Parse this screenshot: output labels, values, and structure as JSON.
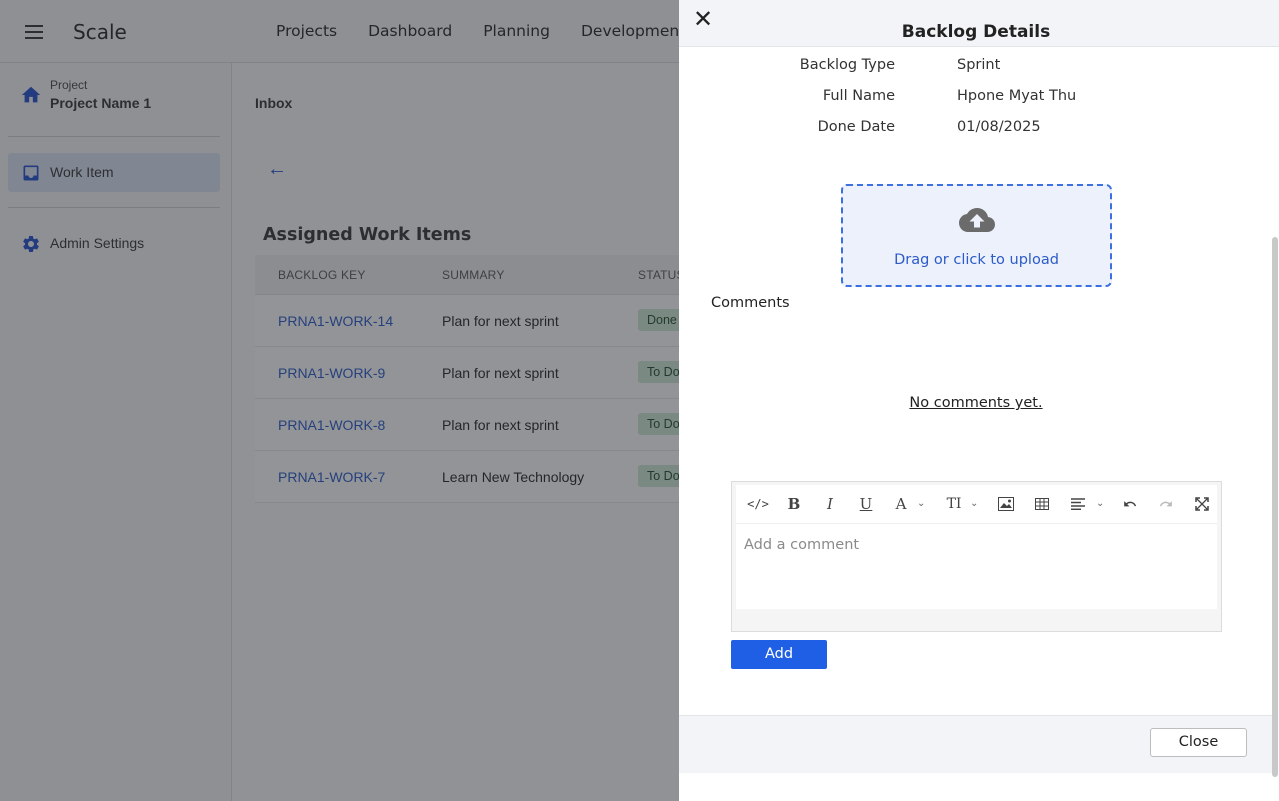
{
  "app": {
    "title": "Scale",
    "nav": [
      "Projects",
      "Dashboard",
      "Planning",
      "Development"
    ]
  },
  "sidebar": {
    "project_caption": "Project",
    "project_name": "Project Name 1",
    "items": [
      {
        "label": "Work Item",
        "icon": "inbox-icon",
        "active": true
      },
      {
        "label": "Admin Settings",
        "icon": "gear-icon",
        "active": false
      }
    ]
  },
  "main": {
    "breadcrumb": "Inbox",
    "back_icon": "←",
    "section_title": "Assigned Work Items",
    "columns": [
      "BACKLOG KEY",
      "SUMMARY",
      "STATUS"
    ],
    "rows": [
      {
        "key": "PRNA1-WORK-14",
        "summary": "Plan for next sprint",
        "status": "Done"
      },
      {
        "key": "PRNA1-WORK-9",
        "summary": "Plan for next sprint",
        "status": "To Do"
      },
      {
        "key": "PRNA1-WORK-8",
        "summary": "Plan for next sprint",
        "status": "To Do"
      },
      {
        "key": "PRNA1-WORK-7",
        "summary": "Learn New Technology",
        "status": "To Do"
      }
    ]
  },
  "drawer": {
    "close_glyph": "✕",
    "title": "Backlog Details",
    "fields": [
      {
        "label": "Backlog Type",
        "value": "Sprint"
      },
      {
        "label": "Full Name",
        "value": "Hpone Myat Thu"
      },
      {
        "label": "Done Date",
        "value": "01/08/2025"
      }
    ],
    "upload_text": "Drag or click to upload",
    "comments_label": "Comments",
    "no_comments": "No comments yet.",
    "editor": {
      "toolbar": {
        "code": "</>",
        "bold": "B",
        "italic": "I",
        "underline": "U",
        "font_color": "A",
        "font_size": "TI"
      },
      "placeholder": "Add a comment"
    },
    "add_label": "Add",
    "close_label": "Close"
  },
  "colors": {
    "accent": "#1e5fe6",
    "link": "#2357c9",
    "status_badge": "#cde8d4",
    "active_sidebar": "#dbe5f5"
  }
}
